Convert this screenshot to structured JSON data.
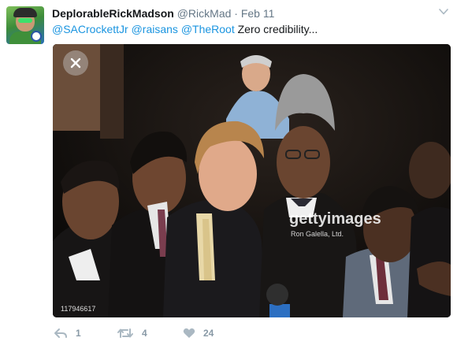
{
  "tweet": {
    "author": {
      "display_name": "DeplorableRickMadson",
      "handle": "@RickMad",
      "separator": "·",
      "timestamp": "Feb 11"
    },
    "text": {
      "mentions": [
        "@SACrockettJr",
        "@raisans",
        "@TheRoot"
      ],
      "body": "Zero credibility..."
    },
    "media": {
      "watermark_brand": "gettyimages",
      "watermark_credit": "Ron Galella, Ltd.",
      "image_id": "117946617"
    },
    "actions": {
      "reply_count": "1",
      "retweet_count": "4",
      "like_count": "24"
    }
  },
  "colors": {
    "link": "#1b95e0",
    "muted": "#657786",
    "action_gray": "#8899a6"
  },
  "icons": [
    "avatar",
    "chevron-down-icon",
    "close-icon",
    "reply-icon",
    "retweet-icon",
    "heart-icon"
  ]
}
